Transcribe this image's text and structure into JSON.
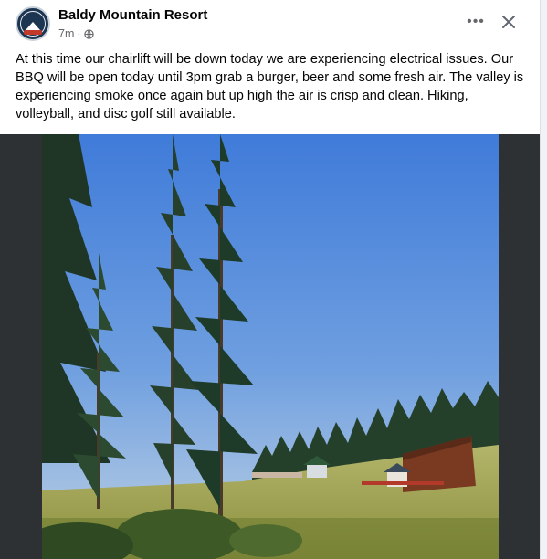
{
  "post": {
    "author": "Baldy Mountain Resort",
    "timestamp": "7m",
    "separator": "·",
    "audience_icon": "globe-icon",
    "more_icon": "more-options-icon",
    "more_glyph": "•••",
    "close_icon": "close-icon",
    "avatar_icon": "resort-logo-avatar",
    "body": "At this time our chairlift will be down today we are experiencing electrical issues. Our BBQ will be open today until 3pm grab a burger, beer and some fresh air. The valley is experiencing smoke once again but up high the air is crisp and clean. Hiking, volleyball, and disc golf still available.",
    "photo": "mountain-resort-photo"
  },
  "colors": {
    "author_text": "#050505",
    "meta_text": "#65676b",
    "photo_frame": "#2e3133",
    "sky_top": "#3a78d6",
    "sky_bottom": "#b7cde3"
  }
}
